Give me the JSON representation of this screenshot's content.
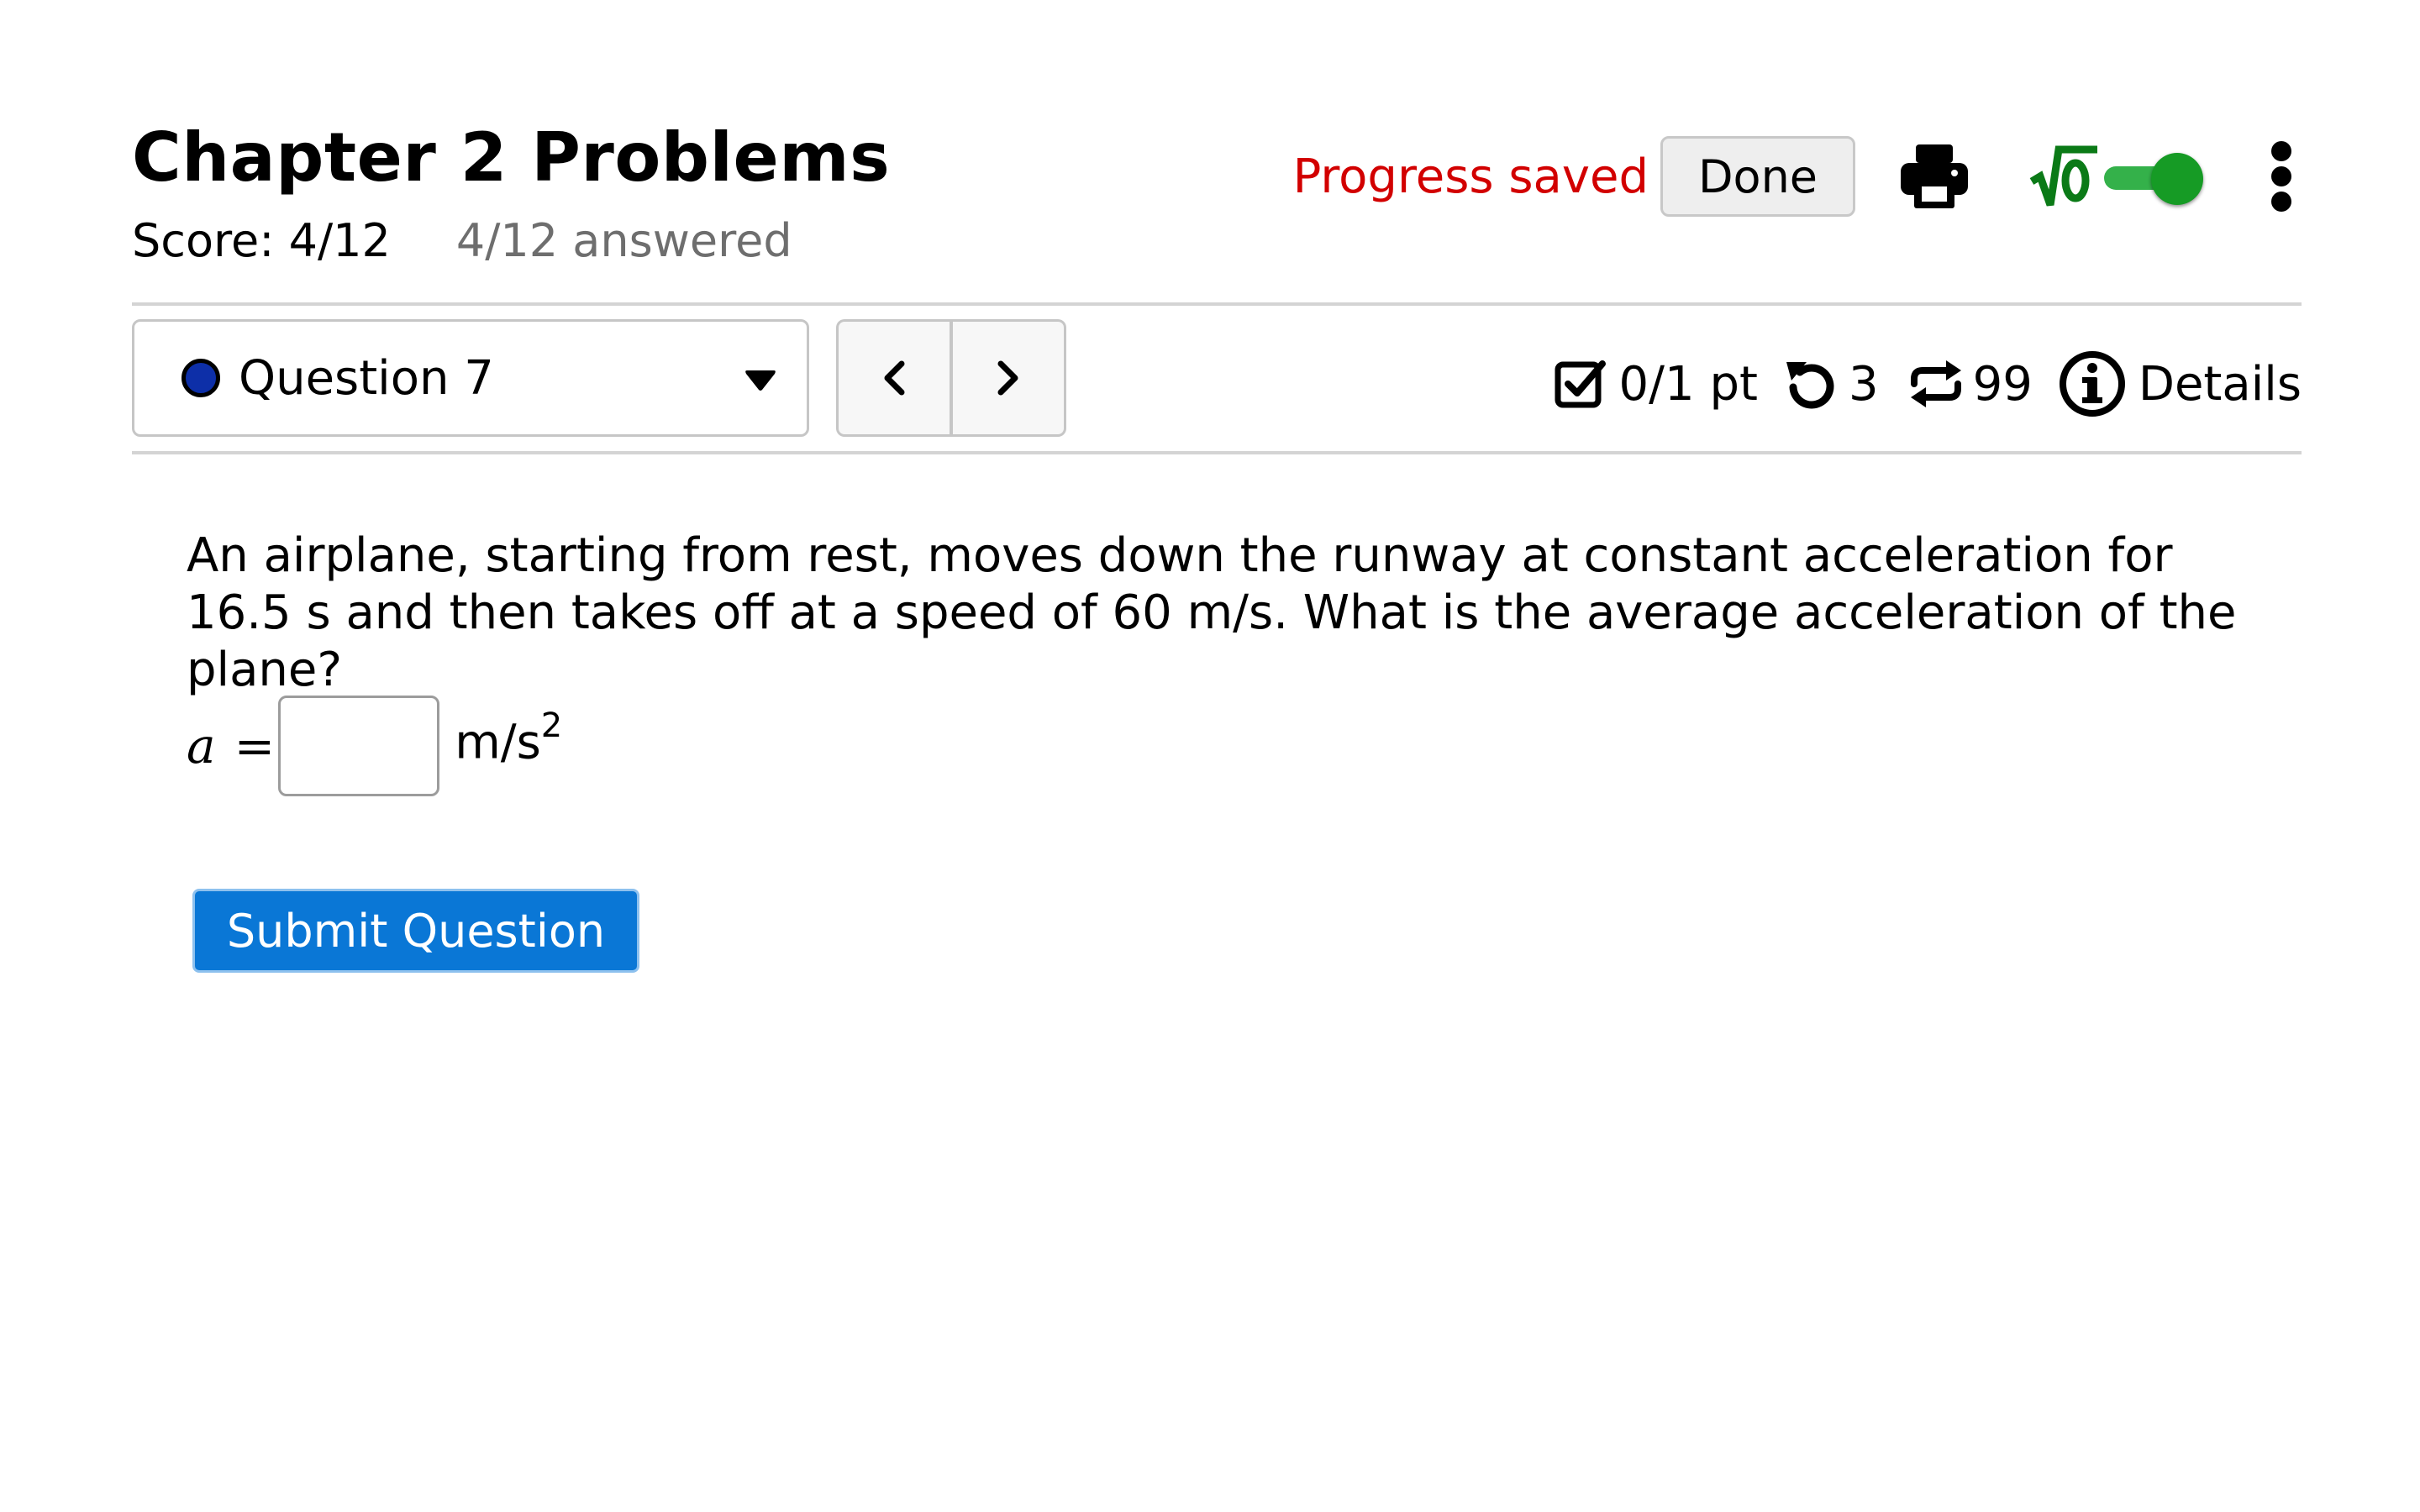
{
  "header": {
    "title": "Chapter 2 Problems",
    "score": "Score: 4/12",
    "answered": "4/12 answered"
  },
  "actions": {
    "progress_status": "Progress saved",
    "done_label": "Done",
    "print_icon": "print-icon",
    "math_icon": "sqrt-icon",
    "math_toggle_on": true,
    "menu_icon": "kebab-icon",
    "progress_color": "#d20000",
    "toggle_color": "#169b25"
  },
  "question_nav": {
    "selected_label": "Question 7",
    "status_color": "#0d2fa8",
    "prev_icon": "chevron-left-icon",
    "next_icon": "chevron-right-icon"
  },
  "meta": {
    "points": "0/1 pt",
    "retries": "3",
    "attempts": "99",
    "details_label": "Details"
  },
  "question": {
    "text": "An airplane, starting from rest, moves down the runway at constant acceleration for 16.5 s and then takes off at a speed of 60 m/s. What is the average acceleration of the plane?",
    "variable": "a",
    "equals": "=",
    "answer_value": "",
    "unit_base": "m/s",
    "unit_exponent": "2"
  },
  "submit": {
    "label": "Submit Question",
    "color": "#0a77d6"
  }
}
